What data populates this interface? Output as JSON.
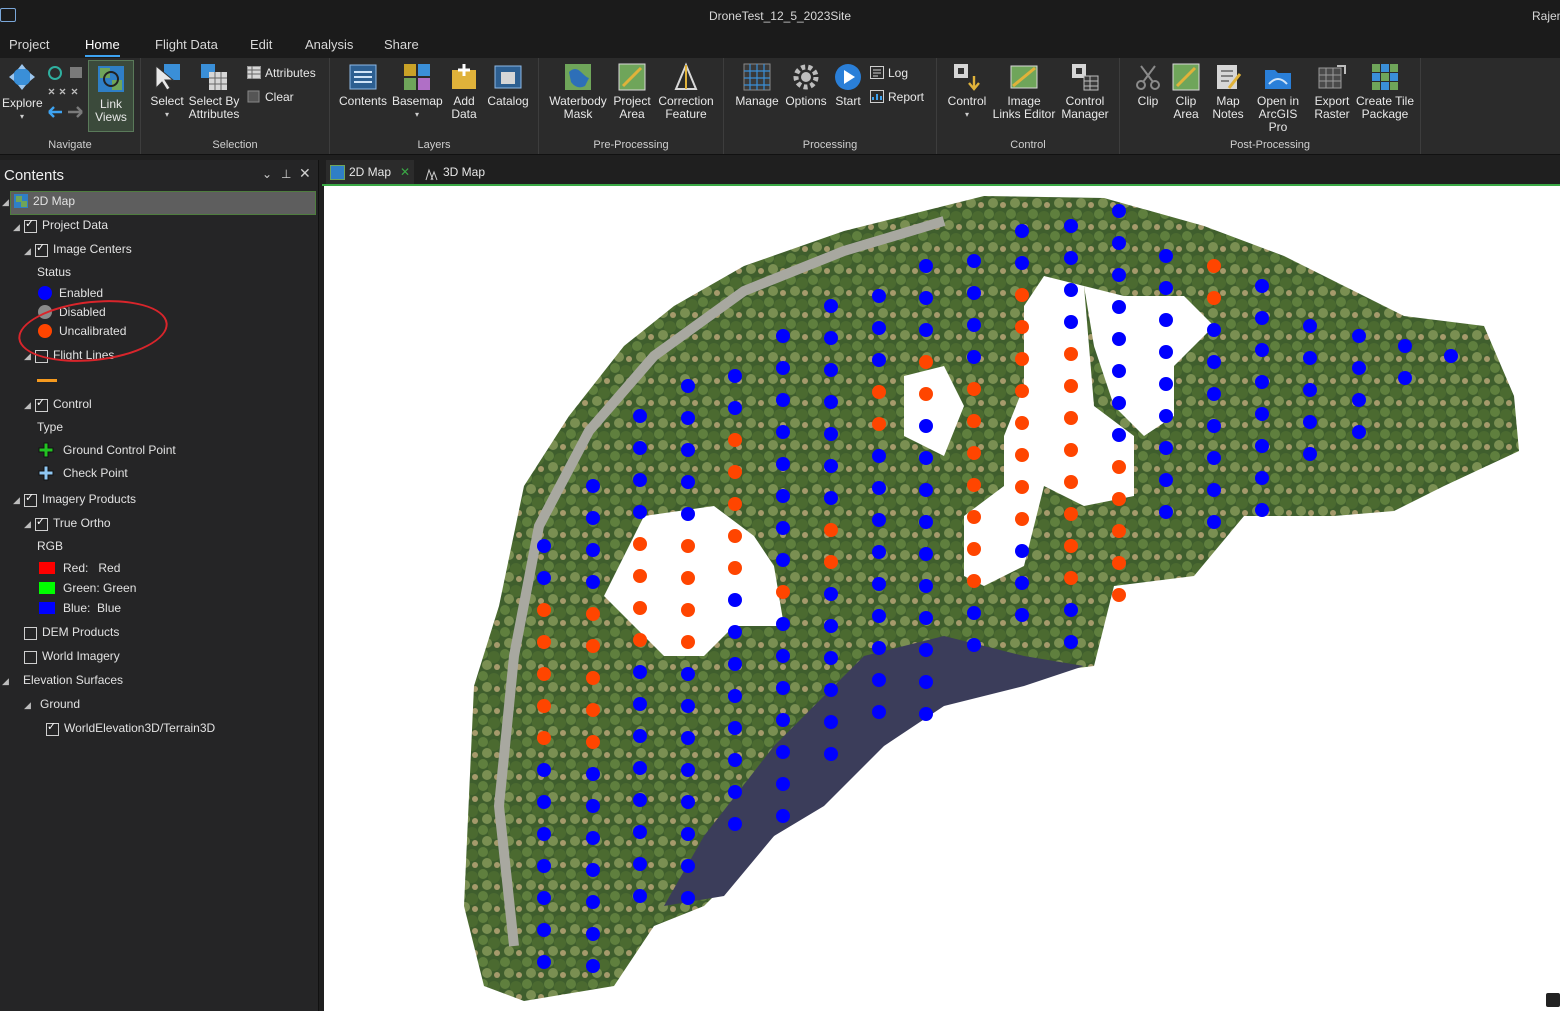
{
  "window": {
    "title": "DroneTest_12_5_2023Site",
    "user": "Rajen"
  },
  "tabs": [
    {
      "label": "Project",
      "active": false
    },
    {
      "label": "Home",
      "active": true
    },
    {
      "label": "Flight Data",
      "active": false
    },
    {
      "label": "Edit",
      "active": false
    },
    {
      "label": "Analysis",
      "active": false
    },
    {
      "label": "Share",
      "active": false
    }
  ],
  "ribbon": {
    "navigate": {
      "label": "Navigate",
      "explore": "Explore",
      "link_views": "Link\nViews"
    },
    "selection": {
      "label": "Selection",
      "select": "Select",
      "select_by_attributes": "Select By\nAttributes",
      "attributes": "Attributes",
      "clear": "Clear"
    },
    "layers": {
      "label": "Layers",
      "contents": "Contents",
      "basemap": "Basemap",
      "add_data": "Add\nData",
      "catalog": "Catalog"
    },
    "preprocessing": {
      "label": "Pre-Processing",
      "waterbody_mask": "Waterbody\nMask",
      "project_area": "Project\nArea",
      "correction_feature": "Correction\nFeature"
    },
    "processing": {
      "label": "Processing",
      "manage": "Manage",
      "options": "Options",
      "start": "Start",
      "log": "Log",
      "report": "Report"
    },
    "control": {
      "label": "Control",
      "control": "Control",
      "image_links_editor": "Image\nLinks Editor",
      "control_manager": "Control\nManager"
    },
    "postprocessing": {
      "label": "Post-Processing",
      "clip": "Clip",
      "clip_area": "Clip\nArea",
      "map_notes": "Map\nNotes",
      "open_in_arcgis_pro": "Open in\nArcGIS Pro",
      "export_raster": "Export\nRaster",
      "create_tile_package": "Create Tile\nPackage"
    }
  },
  "contents": {
    "title": "Contents",
    "map_name": "2D Map",
    "project_data": "Project Data",
    "image_centers": "Image Centers",
    "status_heading": "Status",
    "status_enabled": "Enabled",
    "status_disabled": "Disabled",
    "status_uncalibrated": "Uncalibrated",
    "flight_lines": "Flight Lines",
    "control": "Control",
    "type_heading": "Type",
    "ground_control_point": "Ground Control Point",
    "check_point": "Check Point",
    "imagery_products": "Imagery Products",
    "true_ortho": "True Ortho",
    "rgb_heading": "RGB",
    "band_red": "Red:   Red",
    "band_green": "Green: Green",
    "band_blue": "Blue:  Blue",
    "dem_products": "DEM Products",
    "world_imagery": "World Imagery",
    "elevation_surfaces": "Elevation Surfaces",
    "ground": "Ground",
    "terrain": "WorldElevation3D/Terrain3D"
  },
  "map_tabs": [
    {
      "label": "2D Map",
      "active": true
    },
    {
      "label": "3D Map",
      "active": false
    }
  ],
  "colors": {
    "enabled": "#0000ff",
    "disabled": "#8a8a8a",
    "uncalibrated": "#ff4500",
    "accent": "#3ea3f1",
    "annotation": "#d9252b"
  }
}
